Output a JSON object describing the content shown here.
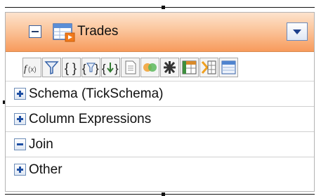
{
  "panel": {
    "title": "Trades",
    "title_icon": "table-icon",
    "collapse_icon": "collapse-box-icon",
    "dropdown_icon": "chevron-down-icon"
  },
  "toolbar": {
    "buttons": [
      {
        "name": "function-icon"
      },
      {
        "name": "filter-icon"
      },
      {
        "name": "braces-icon"
      },
      {
        "name": "filter-braces-icon"
      },
      {
        "name": "sort-braces-icon"
      },
      {
        "name": "document-icon"
      },
      {
        "name": "join-icon"
      },
      {
        "name": "asterisk-icon"
      },
      {
        "name": "pivot-grid-icon"
      },
      {
        "name": "arrow-grid-icon"
      },
      {
        "name": "window-icon"
      }
    ]
  },
  "sections": [
    {
      "label": "Schema (TickSchema)",
      "state": "collapsed"
    },
    {
      "label": "Column Expressions",
      "state": "collapsed"
    },
    {
      "label": "Join",
      "state": "expanded"
    },
    {
      "label": "Other",
      "state": "collapsed"
    }
  ],
  "colors": {
    "header_top": "#fde3cd",
    "header_bottom": "#f79b5c",
    "expander_blue": "#1e4fa3"
  }
}
